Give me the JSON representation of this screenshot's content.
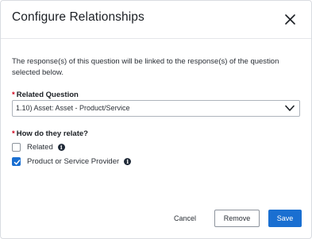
{
  "dialog": {
    "title": "Configure Relationships",
    "description": "The response(s) of this question will be linked to the response(s) of the question selected below."
  },
  "related_question": {
    "required_mark": "*",
    "label": "Related Question",
    "selected_value": "1.10) Asset: Asset - Product/Service"
  },
  "relation": {
    "required_mark": "*",
    "label": "How do they relate?",
    "options": [
      {
        "label": "Related",
        "checked": false,
        "info_icon": "info-icon"
      },
      {
        "label": "Product or Service Provider",
        "checked": true,
        "info_icon": "info-icon"
      }
    ]
  },
  "footer": {
    "cancel_label": "Cancel",
    "remove_label": "Remove",
    "save_label": "Save"
  },
  "colors": {
    "accent": "#1a6fd1",
    "required": "#d0021b"
  }
}
